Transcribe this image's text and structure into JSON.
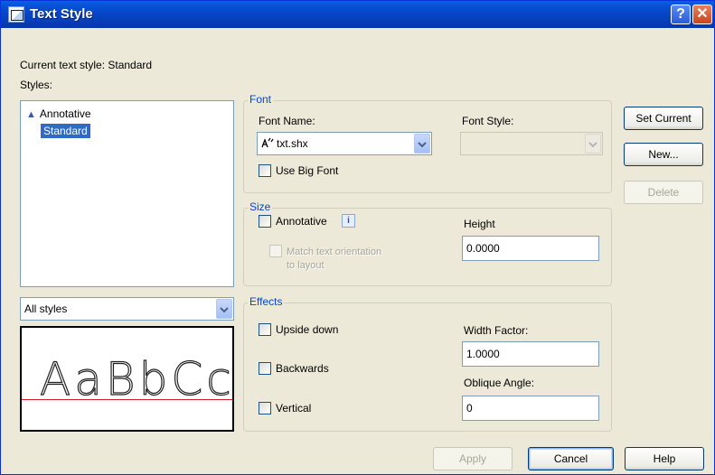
{
  "window": {
    "title": "Text Style"
  },
  "titlebar": {
    "help_glyph": "?",
    "close_glyph": "✕"
  },
  "current_style": {
    "label": "Current text style:",
    "value": "Standard"
  },
  "styles": {
    "label": "Styles:",
    "items": [
      {
        "label": "Annotative",
        "annotative": true,
        "selected": false
      },
      {
        "label": "Standard",
        "annotative": false,
        "selected": true
      }
    ]
  },
  "filter": {
    "value": "All styles"
  },
  "preview": {
    "sample_text": "AaBbCc"
  },
  "font": {
    "group_label": "Font",
    "name_label": "Font Name:",
    "name_value": "txt.shx",
    "style_label": "Font Style:",
    "style_value": "",
    "big_font_label": "Use Big Font",
    "big_font_checked": false
  },
  "size": {
    "group_label": "Size",
    "annotative_label": "Annotative",
    "annotative_checked": false,
    "info_glyph": "i",
    "match_label_line1": "Match text orientation",
    "match_label_line2": "to layout",
    "height_label": "Height",
    "height_value": "0.0000"
  },
  "effects": {
    "group_label": "Effects",
    "upside_down_label": "Upside down",
    "backwards_label": "Backwards",
    "vertical_label": "Vertical",
    "width_factor_label": "Width Factor:",
    "width_factor_value": "1.0000",
    "oblique_label": "Oblique Angle:",
    "oblique_value": "0"
  },
  "buttons": {
    "set_current": "Set Current",
    "new": "New...",
    "delete": "Delete",
    "apply": "Apply",
    "cancel": "Cancel",
    "help": "Help"
  },
  "icons": {
    "annotative": "annotative-triangle-icon",
    "font_type": "shx-font-icon",
    "dropdown": "chevron-down-icon"
  }
}
